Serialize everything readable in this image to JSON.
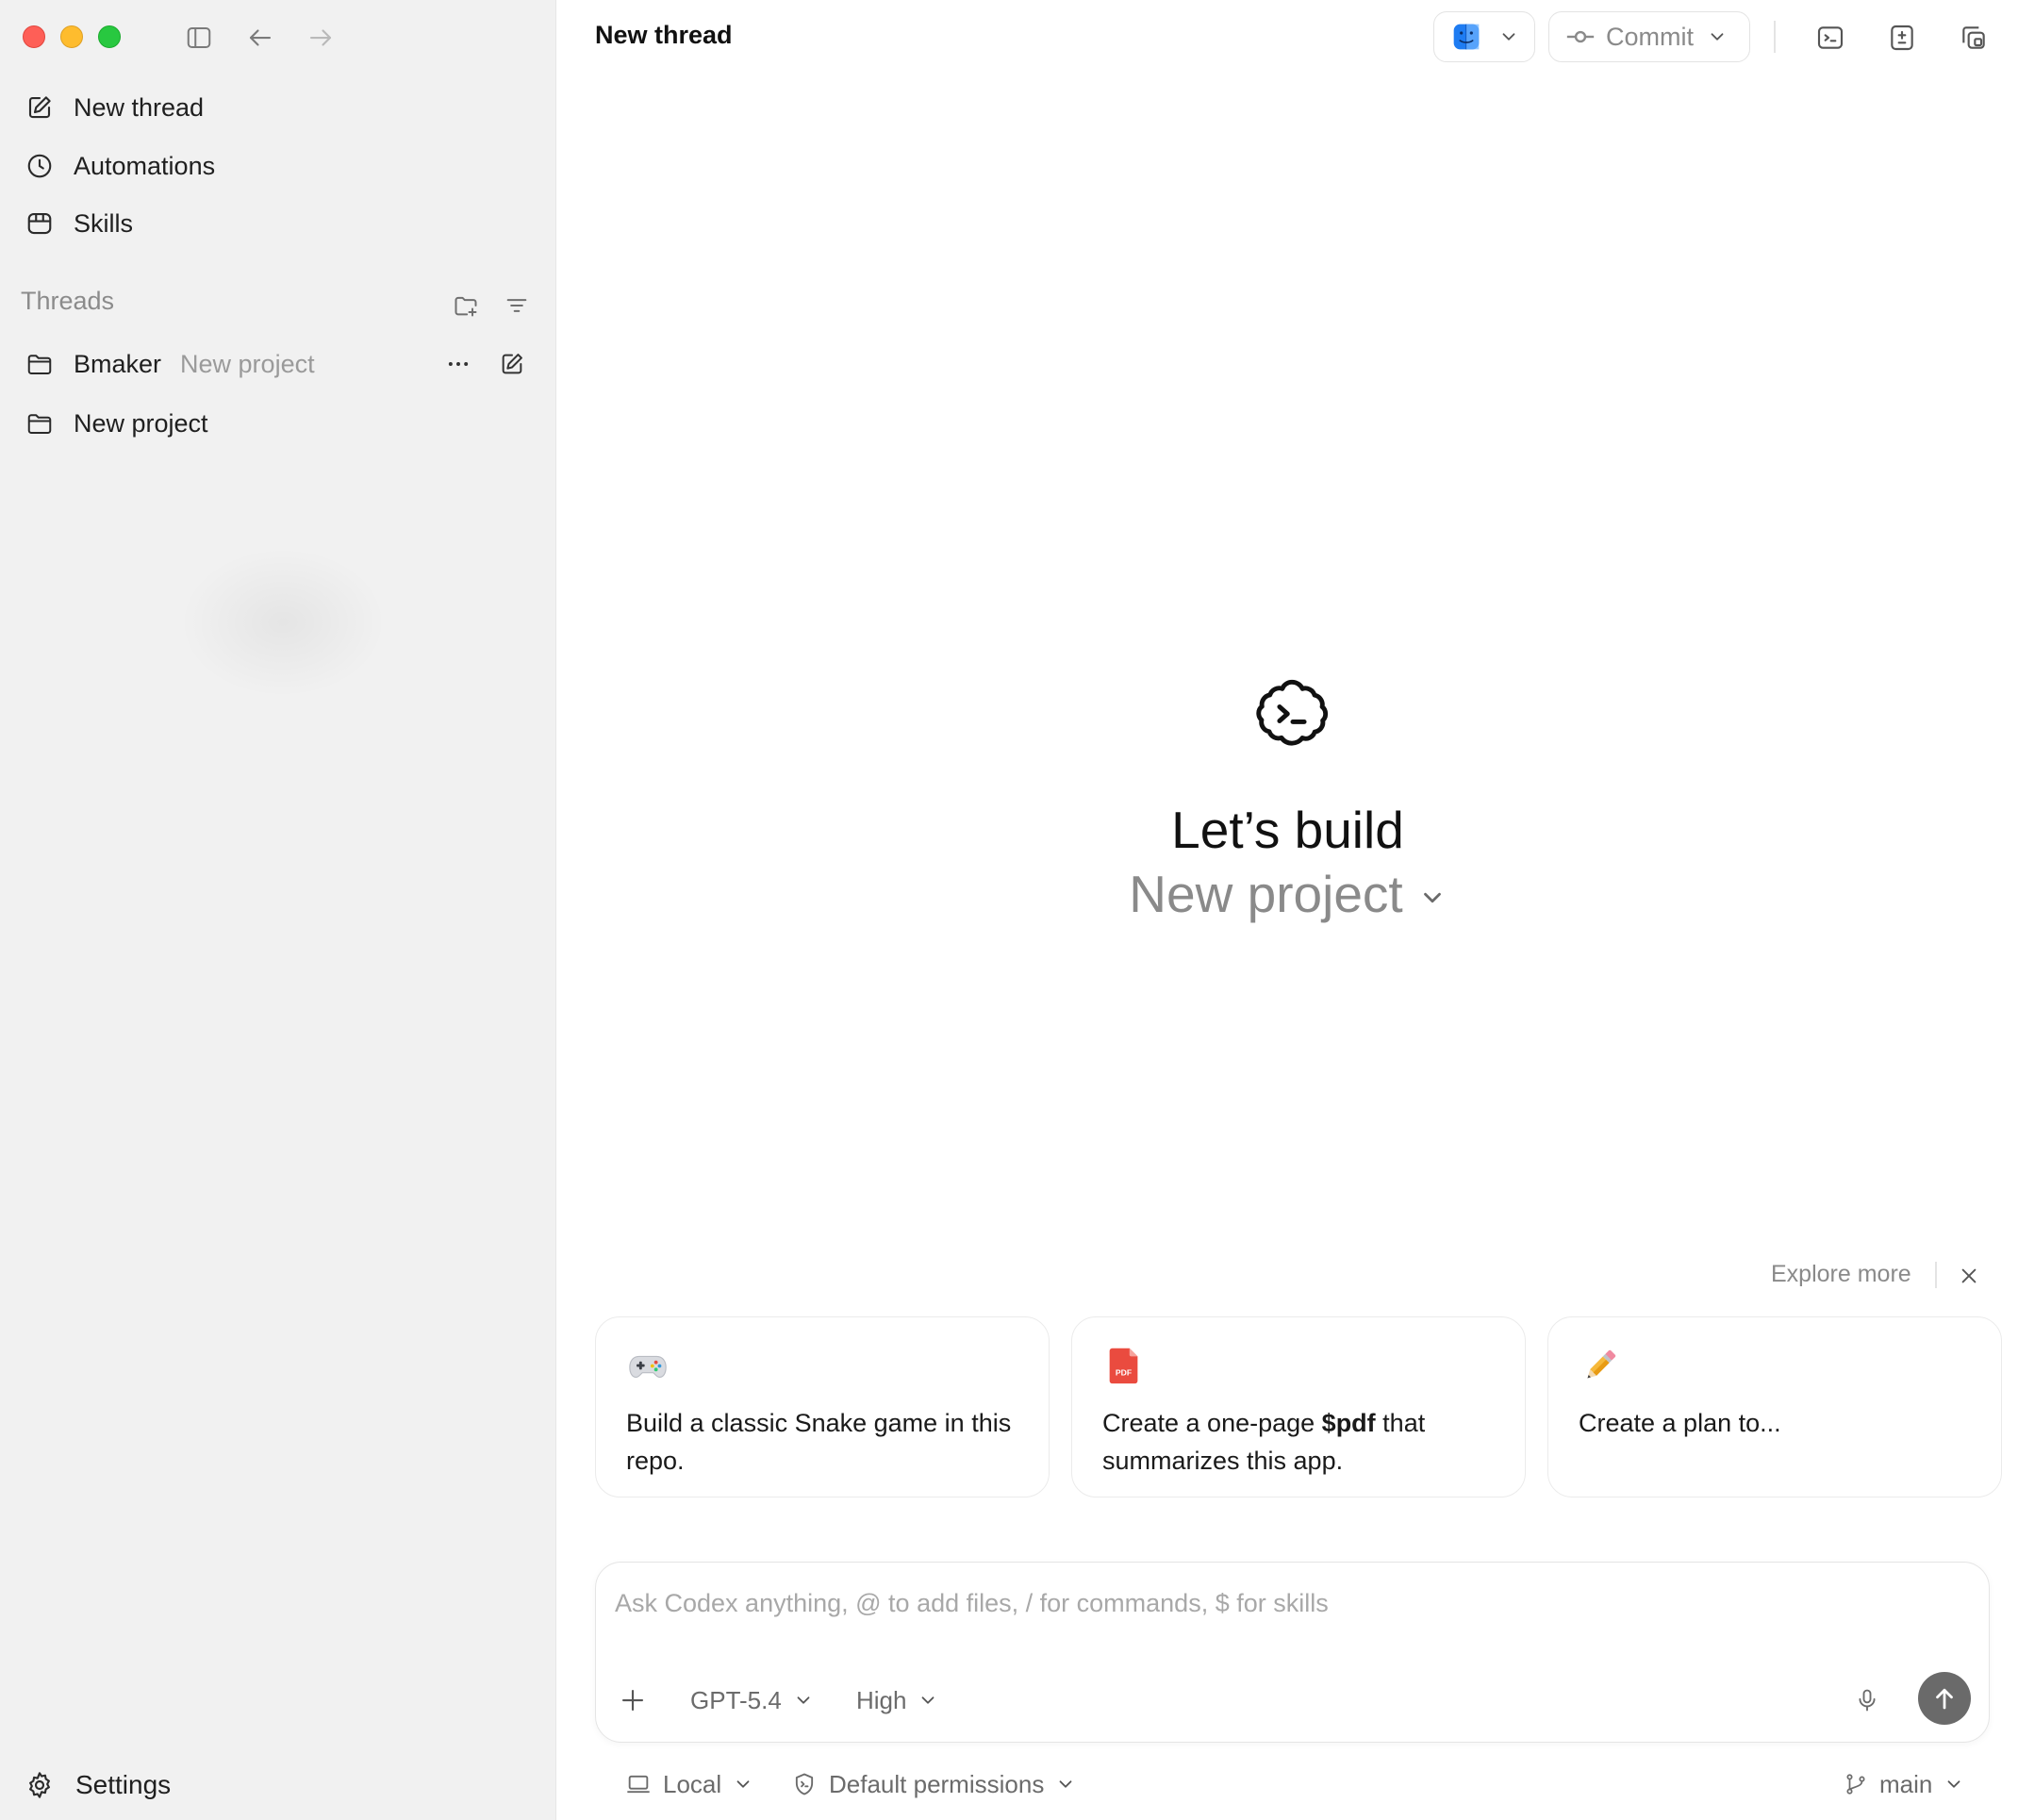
{
  "sidebar": {
    "nav": [
      {
        "label": "New thread",
        "icon": "compose-icon"
      },
      {
        "label": "Automations",
        "icon": "clock-icon"
      },
      {
        "label": "Skills",
        "icon": "skills-icon"
      }
    ],
    "threads_label": "Threads",
    "projects": [
      {
        "name": "Bmaker",
        "subtitle": "New project"
      },
      {
        "name": "New project",
        "subtitle": ""
      }
    ],
    "settings_label": "Settings"
  },
  "header": {
    "title": "New thread",
    "commit_label": "Commit"
  },
  "hero": {
    "title": "Let’s build",
    "project": "New project"
  },
  "suggestions": {
    "explore_label": "Explore more",
    "cards": [
      {
        "icon": "gamepad-icon",
        "text": "Build a classic Snake game in this repo."
      },
      {
        "icon": "pdf-icon",
        "text_before": "Create a one-page ",
        "text_bold": "$pdf",
        "text_after": " that summarizes this app."
      },
      {
        "icon": "pencil-icon",
        "text": "Create a plan to..."
      }
    ]
  },
  "composer": {
    "placeholder": "Ask Codex anything, @ to add files, / for commands, $ for skills",
    "model": "GPT-5.4",
    "reasoning": "High"
  },
  "footer": {
    "environment": "Local",
    "permissions": "Default permissions",
    "branch": "main"
  },
  "colors": {
    "sidebar_bg": "#f1f1f1",
    "traffic_red": "#fe5f57",
    "traffic_yellow": "#febc2e",
    "traffic_green": "#28c840",
    "send_button": "#6a6a6a",
    "muted_text": "#8a8a8a"
  }
}
